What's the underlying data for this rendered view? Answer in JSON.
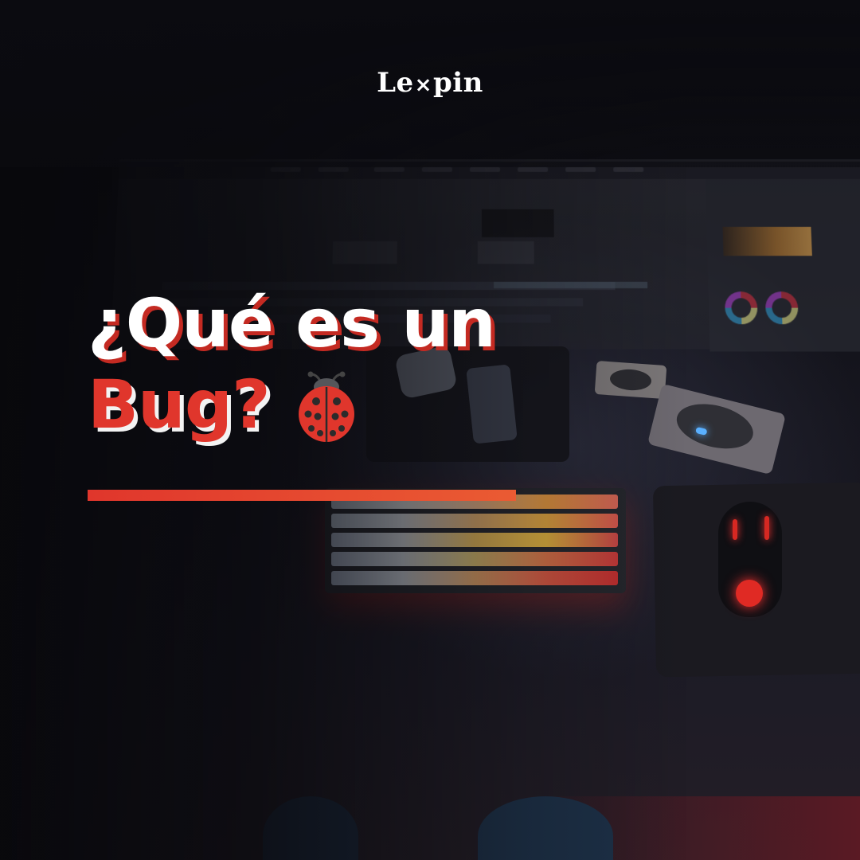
{
  "brand": {
    "name_left": "Le",
    "name_mark": "×",
    "name_right": "pin",
    "logo_icon": "x-mark"
  },
  "headline": {
    "line1": "¿Qué es un",
    "line2": "Bug?",
    "icon": "ladybug-icon"
  },
  "colors": {
    "accent_red": "#e0362c",
    "text_white": "#ffffff",
    "background": "#0b0b10"
  }
}
